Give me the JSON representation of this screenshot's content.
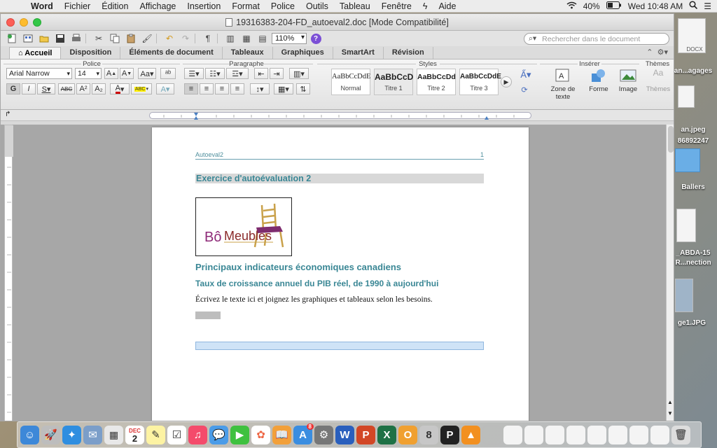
{
  "menubar": {
    "app": "Word",
    "items": [
      "Fichier",
      "Édition",
      "Affichage",
      "Insertion",
      "Format",
      "Police",
      "Outils",
      "Tableau",
      "Fenêtre",
      "Aide"
    ],
    "battery": "40%",
    "clock": "Wed 10:48 AM"
  },
  "window": {
    "title": "19316383-204-FD_autoeval2.doc [Mode Compatibilité]",
    "zoom": "110%",
    "search_placeholder": "Rechercher dans le document"
  },
  "ribbon_tabs": [
    "Accueil",
    "Disposition",
    "Éléments de document",
    "Tableaux",
    "Graphiques",
    "SmartArt",
    "Révision"
  ],
  "ribbon": {
    "groups": {
      "police": "Police",
      "paragraphe": "Paragraphe",
      "styles": "Styles",
      "inserer": "Insérer",
      "themes": "Thèmes"
    },
    "font_name": "Arial Narrow",
    "font_size": "14",
    "styles": [
      {
        "sample": "AaBbCcDdE",
        "name": "Normal"
      },
      {
        "sample": "AaBbCcD",
        "name": "Titre 1"
      },
      {
        "sample": "AaBbCcDd",
        "name": "Titre 2"
      },
      {
        "sample": "AaBbCcDdE",
        "name": "Titre 3"
      }
    ],
    "insert_items": [
      "Zone de texte",
      "Forme",
      "Image"
    ],
    "themes_label": "Thèmes",
    "themes_sample": "Aa"
  },
  "document": {
    "header_left": "Autoeval2",
    "header_right": "1",
    "title": "Exercice d'autoévaluation 2",
    "logo_text_1": "Bô",
    "logo_text_2": "Meubles",
    "heading2": "Principaux indicateurs économiques canadiens",
    "heading3": "Taux de croissance annuel du PIB réel, de 1990 à aujourd'hui",
    "body": "Écrivez le texte ici et joignez les graphiques et tableaux selon les besoins."
  },
  "desktop": {
    "files": [
      "DOCX",
      "an...agages",
      "an.jpeg",
      "86892247",
      "Ballers",
      "_ABDA-15",
      "R...nection",
      "ge1.JPG"
    ]
  },
  "dock": {
    "calendar_month": "DEC",
    "calendar_day": "2",
    "badge": "8"
  }
}
